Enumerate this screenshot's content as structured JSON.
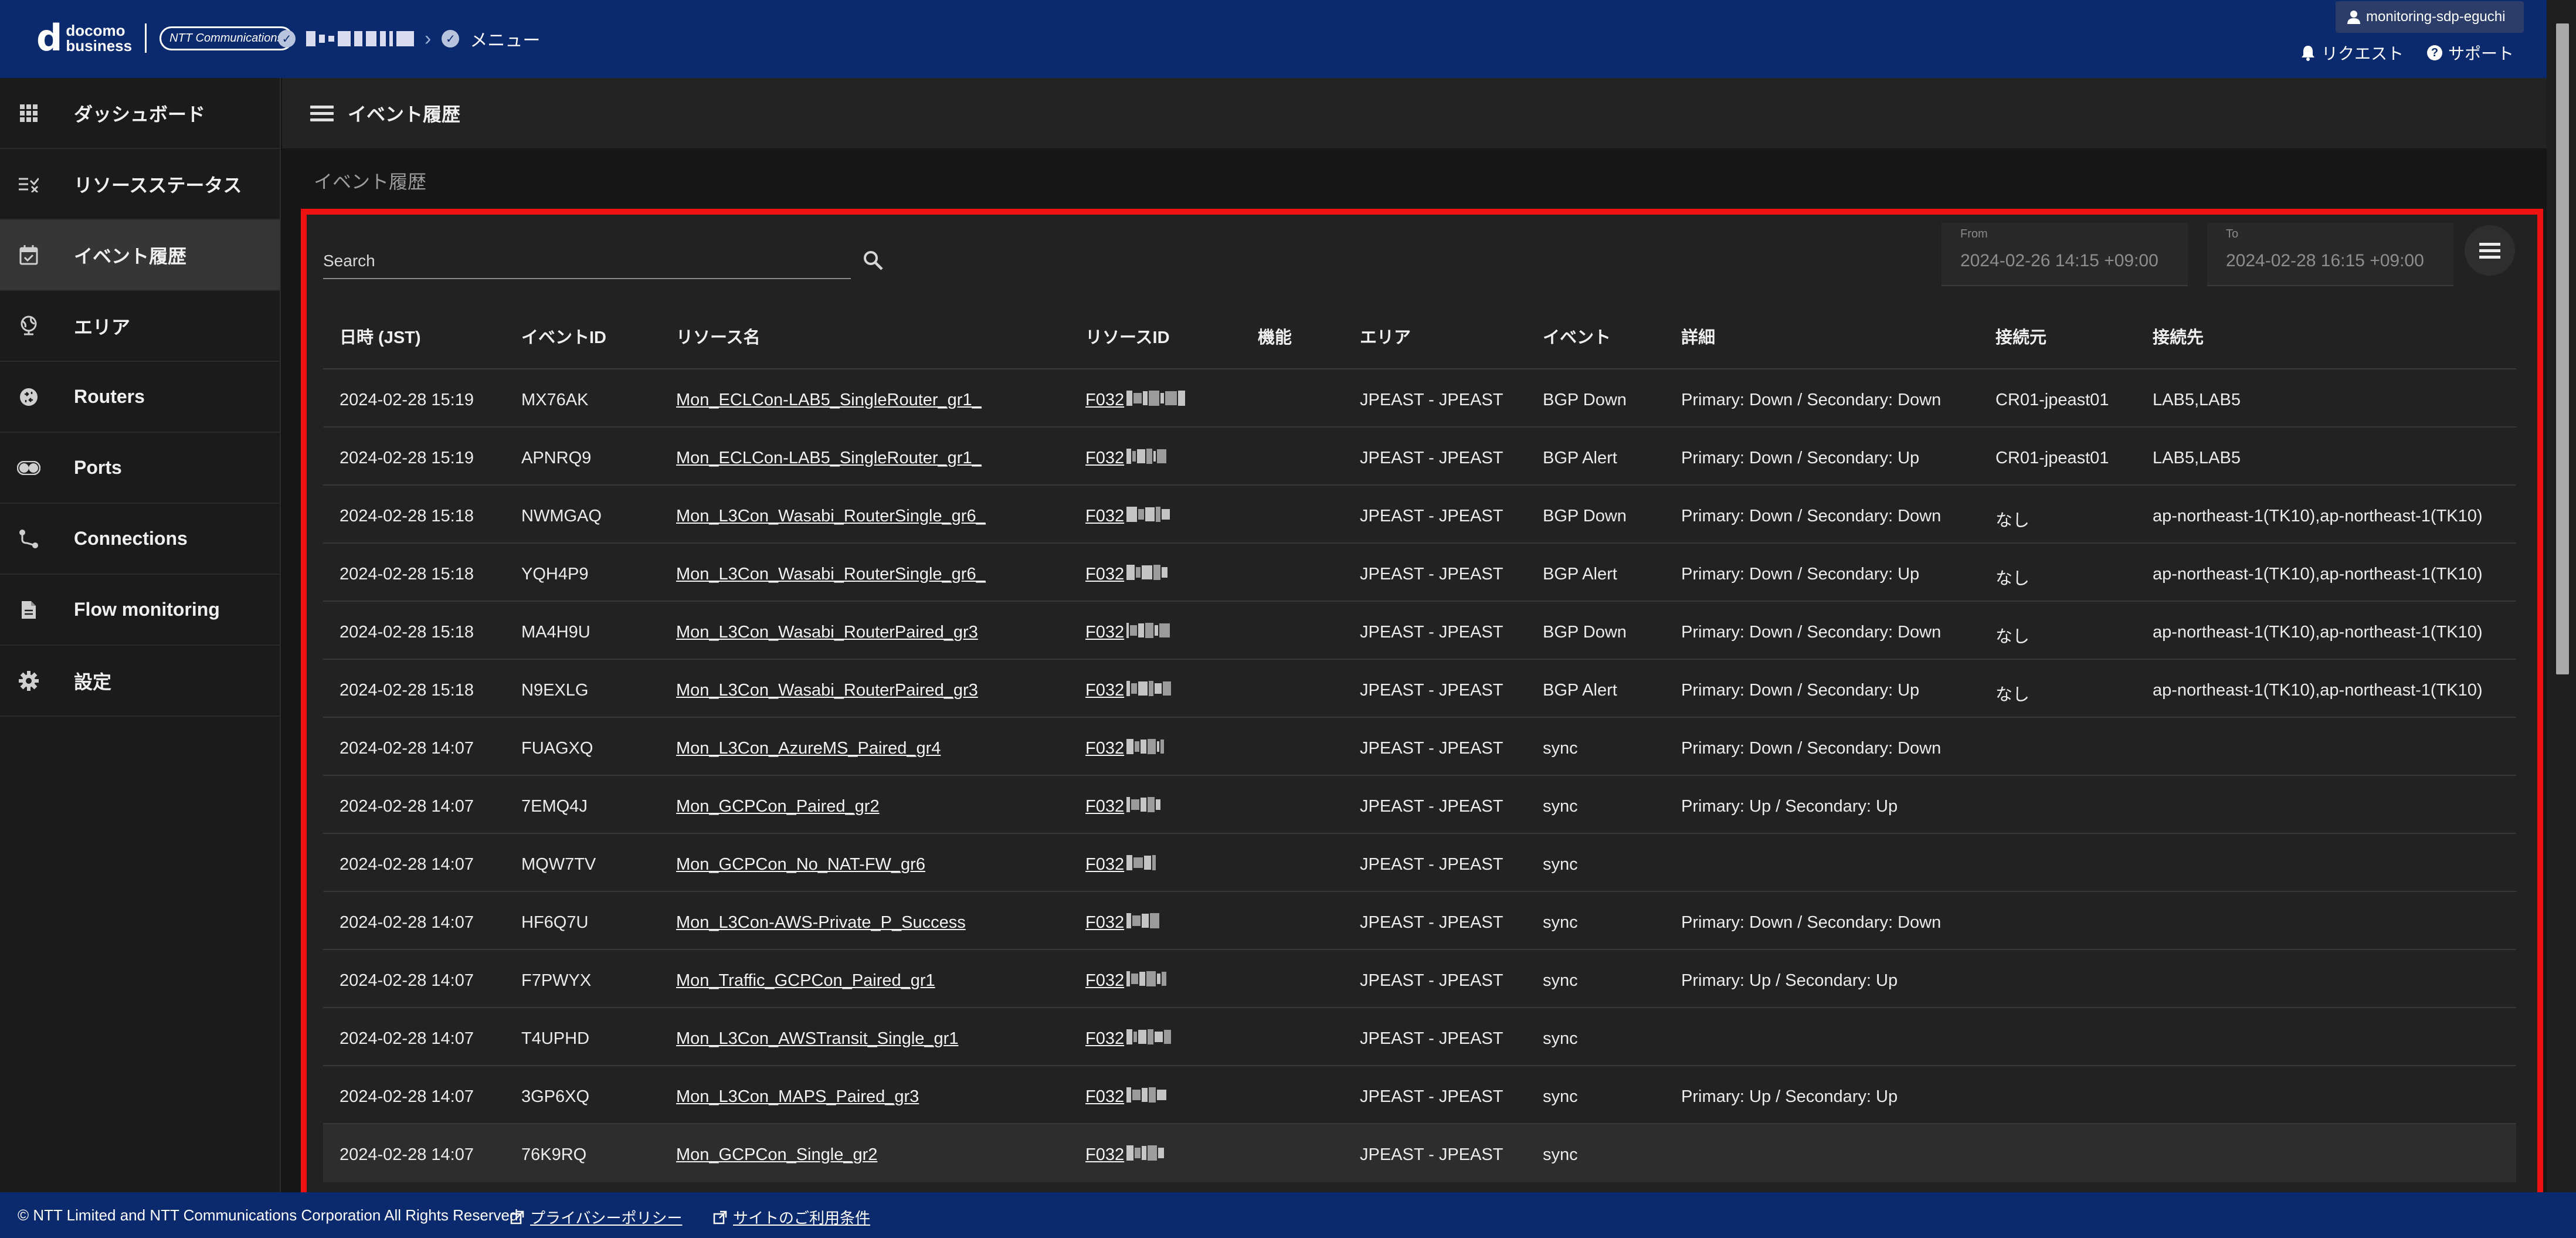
{
  "header": {
    "brand_top": "docomo",
    "brand_bottom": "business",
    "brand_ntt": "NTT Communications",
    "crumb_menu": "メニュー",
    "user": "monitoring-sdp-eguchi",
    "request_label": "リクエスト",
    "support_label": "サポート"
  },
  "sidebar": {
    "items": [
      {
        "label": "ダッシュボード",
        "icon": "grid-icon"
      },
      {
        "label": "リソースステータス",
        "icon": "status-list-icon"
      },
      {
        "label": "イベント履歴",
        "icon": "calendar-icon"
      },
      {
        "label": "エリア",
        "icon": "globe-icon"
      },
      {
        "label": "Routers",
        "icon": "router-icon"
      },
      {
        "label": "Ports",
        "icon": "toggle-icon"
      },
      {
        "label": "Connections",
        "icon": "connection-icon"
      },
      {
        "label": "Flow monitoring",
        "icon": "document-icon"
      },
      {
        "label": "設定",
        "icon": "gear-icon"
      }
    ]
  },
  "content": {
    "page_title": "イベント履歴",
    "subtitle": "イベント履歴"
  },
  "filters": {
    "search_placeholder": "Search",
    "from_label": "From",
    "from_value": "2024-02-26 14:15 +09:00",
    "to_label": "To",
    "to_value": "2024-02-28 16:15 +09:00"
  },
  "table": {
    "columns": [
      "日時 (JST)",
      "イベントID",
      "リソース名",
      "リソースID",
      "機能",
      "エリア",
      "イベント",
      "詳細",
      "接続元",
      "接続先"
    ],
    "rows": [
      {
        "datetime": "2024-02-28 15:19",
        "event_id": "MX76AK",
        "resource_name": "Mon_ECLCon-LAB5_SingleRouter_gr1_",
        "resource_id": "F032",
        "function": "",
        "area": "JPEAST - JPEAST",
        "event": "BGP Down",
        "detail": "Primary: Down / Secondary: Down",
        "source": "CR01-jpeast01",
        "dest": "LAB5,LAB5"
      },
      {
        "datetime": "2024-02-28 15:19",
        "event_id": "APNRQ9",
        "resource_name": "Mon_ECLCon-LAB5_SingleRouter_gr1_",
        "resource_id": "F032",
        "function": "",
        "area": "JPEAST - JPEAST",
        "event": "BGP Alert",
        "detail": "Primary: Down / Secondary: Up",
        "source": "CR01-jpeast01",
        "dest": "LAB5,LAB5"
      },
      {
        "datetime": "2024-02-28 15:18",
        "event_id": "NWMGAQ",
        "resource_name": "Mon_L3Con_Wasabi_RouterSingle_gr6_",
        "resource_id": "F032",
        "function": "",
        "area": "JPEAST - JPEAST",
        "event": "BGP Down",
        "detail": "Primary: Down / Secondary: Down",
        "source": "なし",
        "dest": "ap-northeast-1(TK10),ap-northeast-1(TK10)"
      },
      {
        "datetime": "2024-02-28 15:18",
        "event_id": "YQH4P9",
        "resource_name": "Mon_L3Con_Wasabi_RouterSingle_gr6_",
        "resource_id": "F032",
        "function": "",
        "area": "JPEAST - JPEAST",
        "event": "BGP Alert",
        "detail": "Primary: Down / Secondary: Up",
        "source": "なし",
        "dest": "ap-northeast-1(TK10),ap-northeast-1(TK10)"
      },
      {
        "datetime": "2024-02-28 15:18",
        "event_id": "MA4H9U",
        "resource_name": "Mon_L3Con_Wasabi_RouterPaired_gr3",
        "resource_id": "F032",
        "function": "",
        "area": "JPEAST - JPEAST",
        "event": "BGP Down",
        "detail": "Primary: Down / Secondary: Down",
        "source": "なし",
        "dest": "ap-northeast-1(TK10),ap-northeast-1(TK10)"
      },
      {
        "datetime": "2024-02-28 15:18",
        "event_id": "N9EXLG",
        "resource_name": "Mon_L3Con_Wasabi_RouterPaired_gr3",
        "resource_id": "F032",
        "function": "",
        "area": "JPEAST - JPEAST",
        "event": "BGP Alert",
        "detail": "Primary: Down / Secondary: Up",
        "source": "なし",
        "dest": "ap-northeast-1(TK10),ap-northeast-1(TK10)"
      },
      {
        "datetime": "2024-02-28 14:07",
        "event_id": "FUAGXQ",
        "resource_name": "Mon_L3Con_AzureMS_Paired_gr4",
        "resource_id": "F032",
        "function": "",
        "area": "JPEAST - JPEAST",
        "event": "sync",
        "detail": "Primary: Down / Secondary: Down",
        "source": "",
        "dest": ""
      },
      {
        "datetime": "2024-02-28 14:07",
        "event_id": "7EMQ4J",
        "resource_name": "Mon_GCPCon_Paired_gr2",
        "resource_id": "F032",
        "function": "",
        "area": "JPEAST - JPEAST",
        "event": "sync",
        "detail": "Primary: Up / Secondary: Up",
        "source": "",
        "dest": ""
      },
      {
        "datetime": "2024-02-28 14:07",
        "event_id": "MQW7TV",
        "resource_name": "Mon_GCPCon_No_NAT-FW_gr6",
        "resource_id": "F032",
        "function": "",
        "area": "JPEAST - JPEAST",
        "event": "sync",
        "detail": "",
        "source": "",
        "dest": ""
      },
      {
        "datetime": "2024-02-28 14:07",
        "event_id": "HF6Q7U",
        "resource_name": "Mon_L3Con-AWS-Private_P_Success",
        "resource_id": "F032",
        "function": "",
        "area": "JPEAST - JPEAST",
        "event": "sync",
        "detail": "Primary: Down / Secondary: Down",
        "source": "",
        "dest": ""
      },
      {
        "datetime": "2024-02-28 14:07",
        "event_id": "F7PWYX",
        "resource_name": "Mon_Traffic_GCPCon_Paired_gr1",
        "resource_id": "F032",
        "function": "",
        "area": "JPEAST - JPEAST",
        "event": "sync",
        "detail": "Primary: Up / Secondary: Up",
        "source": "",
        "dest": ""
      },
      {
        "datetime": "2024-02-28 14:07",
        "event_id": "T4UPHD",
        "resource_name": "Mon_L3Con_AWSTransit_Single_gr1",
        "resource_id": "F032",
        "function": "",
        "area": "JPEAST - JPEAST",
        "event": "sync",
        "detail": "",
        "source": "",
        "dest": ""
      },
      {
        "datetime": "2024-02-28 14:07",
        "event_id": "3GP6XQ",
        "resource_name": "Mon_L3Con_MAPS_Paired_gr3",
        "resource_id": "F032",
        "function": "",
        "area": "JPEAST - JPEAST",
        "event": "sync",
        "detail": "Primary: Up / Secondary: Up",
        "source": "",
        "dest": ""
      },
      {
        "datetime": "2024-02-28 14:07",
        "event_id": "76K9RQ",
        "resource_name": "Mon_GCPCon_Single_gr2",
        "resource_id": "F032",
        "function": "",
        "area": "JPEAST - JPEAST",
        "event": "sync",
        "detail": "",
        "source": "",
        "dest": ""
      }
    ]
  },
  "footer": {
    "copyright": "© NTT Limited and NTT Communications Corporation All Rights Reserved.",
    "privacy": "プライバシーポリシー",
    "terms": "サイトのご利用条件"
  },
  "colors": {
    "header_bg": "#0b2a6e",
    "highlight_border": "#ee1111",
    "sidebar_bg": "#1b1b1b",
    "table_bg": "#222222"
  }
}
